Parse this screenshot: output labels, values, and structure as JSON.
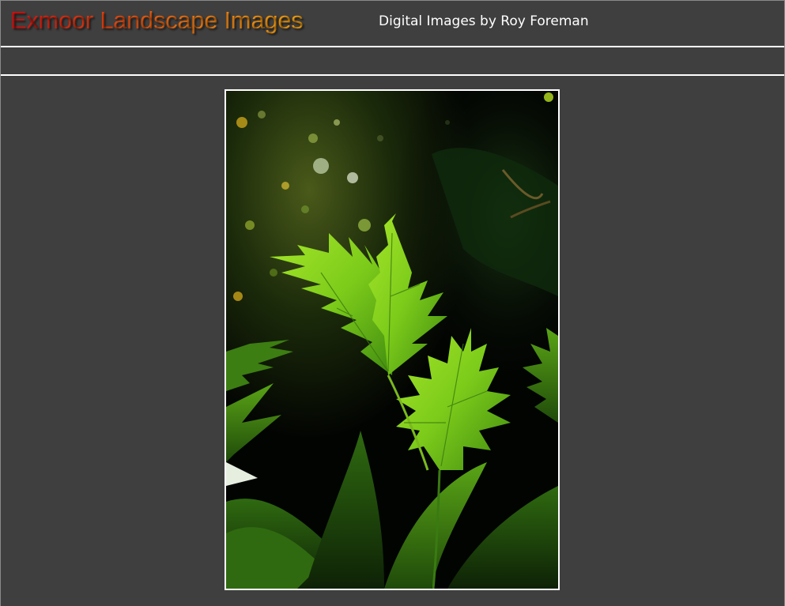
{
  "header": {
    "site_title": "Exmoor Landscape Images",
    "subtitle": "Digital Images by Roy Foreman"
  },
  "photo": {
    "subject": "backlit-green-leaves",
    "colors": {
      "frame": "#ffffff",
      "background": "#3f3f3f",
      "leaf_bright": "#8bd81e",
      "leaf_mid": "#4f9a12",
      "leaf_dark": "#1f4a0a"
    }
  }
}
